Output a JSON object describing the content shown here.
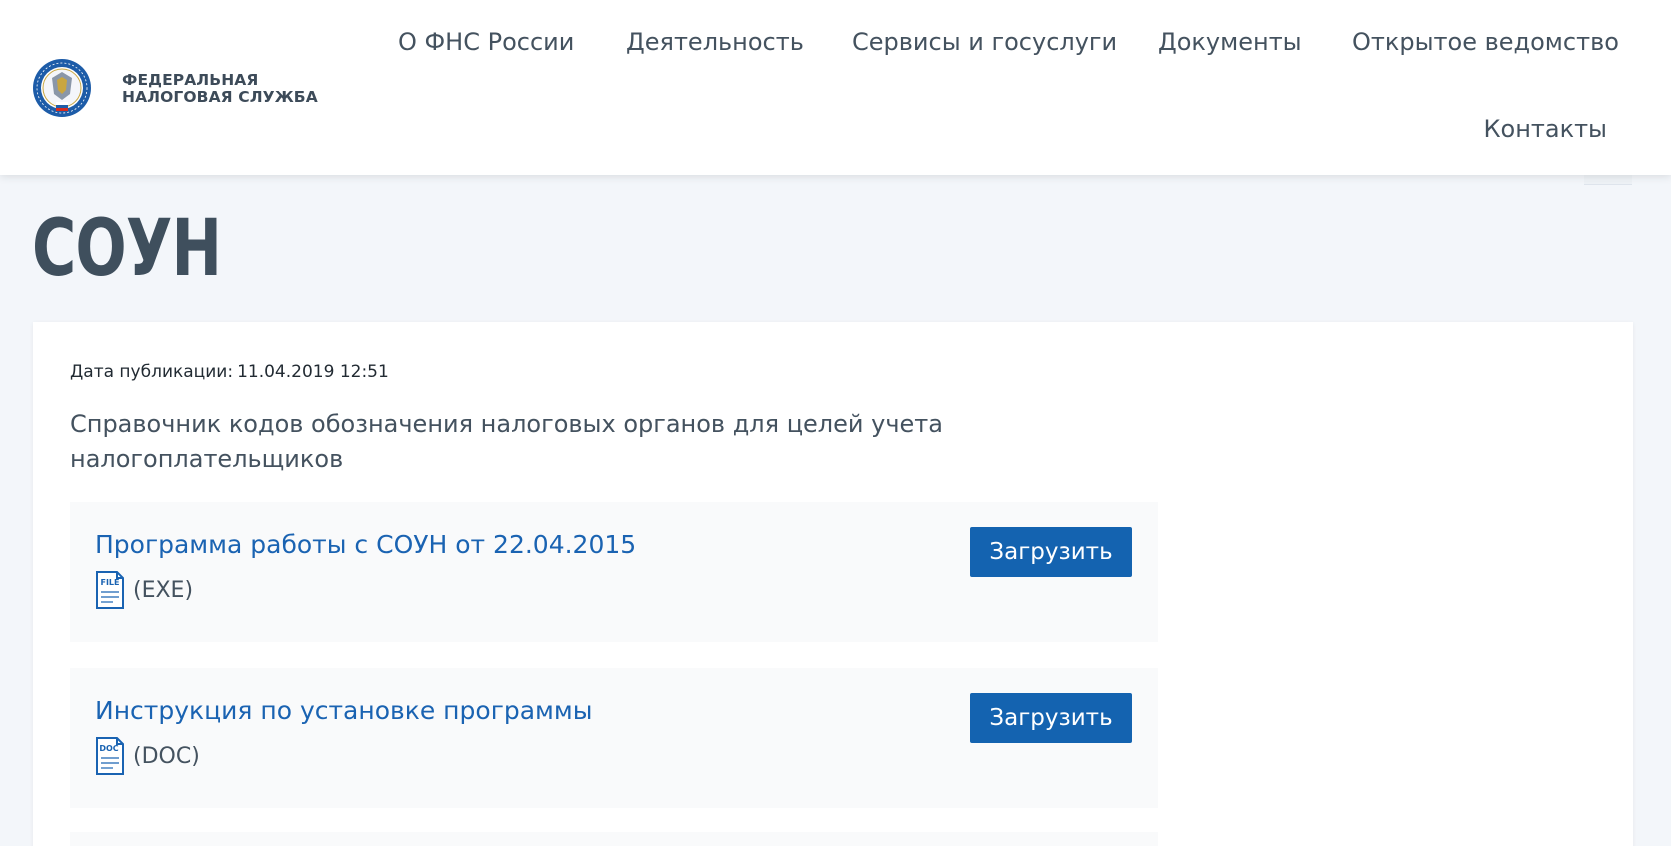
{
  "logo": {
    "line1": "ФЕДЕРАЛЬНАЯ",
    "line2": "НАЛОГОВАЯ СЛУЖБА",
    "emblem_icon": "fns-emblem-icon"
  },
  "nav": {
    "items": [
      {
        "label": "О ФНС России"
      },
      {
        "label": "Деятельность"
      },
      {
        "label": "Сервисы и госуслуги"
      },
      {
        "label": "Документы"
      },
      {
        "label": "Открытое ведомство"
      },
      {
        "label": "Контакты"
      }
    ]
  },
  "page": {
    "title": "СОУН",
    "pub_label": "Дата публикации:",
    "pub_date": "11.04.2019 12:51",
    "description": "Справочник кодов обозначения налоговых органов для целей учета налогоплательщиков"
  },
  "files": [
    {
      "title": "Программа работы с СОУН от 22.04.2015",
      "icon_label": "FILE",
      "ext": "(EXE)",
      "button": "Загрузить"
    },
    {
      "title": "Инструкция по установке программы",
      "icon_label": "DOC",
      "ext": "(DOC)",
      "button": "Загрузить"
    }
  ],
  "colors": {
    "accent": "#1463b0",
    "link": "#1a63b2",
    "text": "#44525f",
    "background": "#f3f6fa"
  }
}
